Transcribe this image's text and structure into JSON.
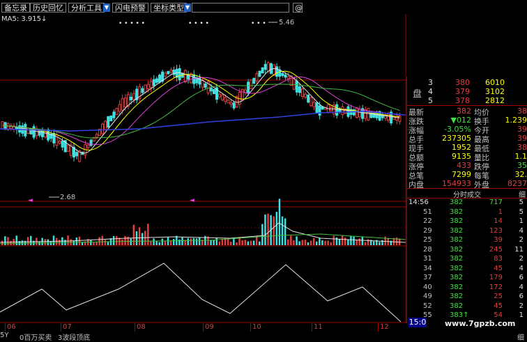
{
  "toolbar": {
    "buttons": [
      "备忘录",
      "历史回忆",
      "分析工具",
      "闪电预警",
      "坐标类型"
    ],
    "right_button": "@"
  },
  "ma_line": {
    "label": "MA5: 3.915",
    "marker": "↓",
    "high_label": "5.46",
    "low_label": "2.68"
  },
  "quote_panel": {
    "side_label": "盘",
    "top_rows": [
      {
        "idx": "3",
        "price": "380",
        "vol": "6010"
      },
      {
        "idx": "4",
        "price": "379",
        "vol": "3102"
      },
      {
        "idx": "5",
        "price": "378",
        "vol": "2812"
      }
    ],
    "stats": [
      {
        "l1": "最新",
        "v1": "382",
        "l2": "均价",
        "v2": "38"
      },
      {
        "l1": "涨跌",
        "v1": "▼012",
        "l2": "换手",
        "v2": "1.239"
      },
      {
        "l1": "涨幅",
        "v1": "-3.05%",
        "l2": "今开",
        "v2": "39"
      },
      {
        "l1": "总手",
        "v1": "237305",
        "l2": "最高",
        "v2": "39"
      },
      {
        "l1": "现手",
        "v1": "1952",
        "l2": "最低",
        "v2": "38"
      },
      {
        "l1": "总额",
        "v1": "9135",
        "l2": "量比",
        "v2": "1.1"
      },
      {
        "l1": "涨停",
        "v1": "433",
        "l2": "跌停",
        "v2": "35"
      },
      {
        "l1": "总笔",
        "v1": "7299",
        "l2": "每笔",
        "v2": "32."
      },
      {
        "l1": "内盘",
        "v1": "154933",
        "l2": "外盘",
        "v2": "8237"
      }
    ],
    "ticks_header": "分时成交",
    "ticks_header_right": "细",
    "ticks": [
      {
        "t": "14:56",
        "p": "382",
        "v": "717",
        "n": "5"
      },
      {
        "t": "51",
        "p": "382",
        "v": "1",
        "n": "5"
      },
      {
        "t": "22",
        "p": "382",
        "v": "14",
        "n": "1"
      },
      {
        "t": "29",
        "p": "382",
        "v": "123",
        "n": "4"
      },
      {
        "t": "25",
        "p": "382",
        "v": "39",
        "n": "2"
      },
      {
        "t": "28",
        "p": "382",
        "v": "245",
        "n": "11"
      },
      {
        "t": "31",
        "p": "382",
        "v": "83",
        "n": "2"
      },
      {
        "t": "34",
        "p": "382",
        "v": "45",
        "n": "4"
      },
      {
        "t": "37",
        "p": "382",
        "v": "179",
        "n": "6"
      },
      {
        "t": "40",
        "p": "382",
        "v": "172",
        "n": "4"
      },
      {
        "t": "49",
        "p": "382",
        "v": "25",
        "n": "6"
      },
      {
        "t": "52",
        "p": "382",
        "v": "45",
        "n": "2"
      },
      {
        "t": "55",
        "p": "383↑",
        "v": "54",
        "n": "1"
      }
    ],
    "time_box": "15:0",
    "footer_right": "细"
  },
  "date_axis": [
    "06",
    "07",
    "08",
    "09",
    "10",
    "11",
    "12"
  ],
  "status_bar": {
    "left": "5Y",
    "mid1": "0百万买卖",
    "mid2": "3波段顶底"
  },
  "watermark": "www.7gpzb.com",
  "colors": {
    "up": "#e04040",
    "down": "#40e0e0",
    "text": "#c0c0c0",
    "yellow": "#ffff00",
    "green": "#00e000",
    "magenta": "#e040e0",
    "blue": "#3040e0",
    "border": "#a00000"
  }
}
